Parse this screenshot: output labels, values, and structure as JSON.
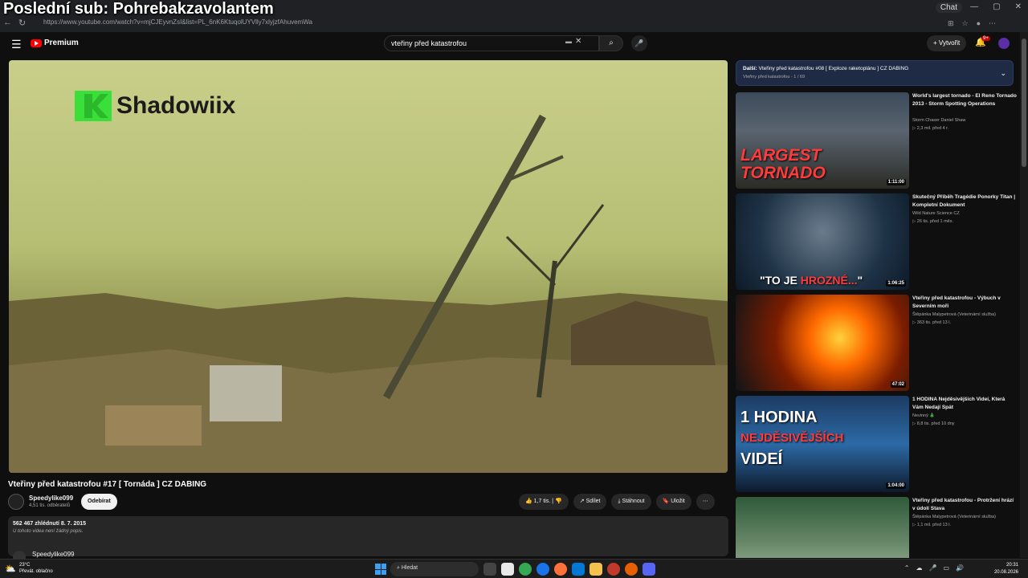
{
  "overlay": {
    "title": "Poslední sub: Pohrebakzavolantem"
  },
  "browser": {
    "url": "https://www.youtube.com/watch?v=mjCJEyvnZsI&list=PL_6nK6KtuqolUYVlly7xlyjzfAhuvemWa",
    "chat_label": "Chat"
  },
  "header": {
    "logo_text": "Premium",
    "search_value": "vteřiny před katastrofou",
    "create_label": "Vytvořit",
    "notif_badge": "9+"
  },
  "video": {
    "watermark": "Shadowiix",
    "title": "Vteřiny před katastrofou #17 [ Tornáda ] CZ DABING",
    "channel": "Speedylike099",
    "subscribers": "4,51 tis. odběratelů",
    "subscribe_label": "Odebírat",
    "likes": "1,7 tis.",
    "share_label": "Sdílet",
    "download_label": "Stáhnout",
    "save_label": "Uložit",
    "views_date": "562 467 zhlédnutí  8. 7. 2015",
    "description": "U tohoto videa není žádný popis.",
    "comment_author": "Speedylike099"
  },
  "next": {
    "label": "Další:",
    "title": "Vteřiny před katastrofou #08 [ Exploze raketoplánu ] CZ DABING",
    "sub": "Vteřiny před katastrofou - 1 / 69"
  },
  "recommendations": [
    {
      "title": "World's largest tornado - El Reno Tornado 2013 - Storm Spotting Operations",
      "channel": "Storm Chaser Daniel Shaw",
      "meta": "▷ 2,3 mil.   před 4 r.",
      "duration": "1:11:00",
      "thumb_text": "LARGEST TORNADO"
    },
    {
      "title": "Skutečný Příběh Tragédie Ponorky Titan | Kompletní Dokument",
      "channel": "Wild Nature Science CZ",
      "meta": "▷ 26 tis.   před 1 měs.",
      "duration": "1:06:25",
      "thumb_text_1": "\"TO JE ",
      "thumb_text_2": "HROZNÉ...",
      "thumb_text_3": "\""
    },
    {
      "title": "Vteřiny před katastrofou - Výbuch v Severním moři",
      "channel": "Štěpánka Malypetrová (Veterinární služba)",
      "meta": "▷ 363 tis.   před 13 l.",
      "duration": "47:02"
    },
    {
      "title": "1 HODINA Nejděsivějších Videí, Která Vám Nedají Spát",
      "channel": "Nevinný 🎄",
      "meta": "▷ 8,8 tis.   před 10 dny",
      "duration": "1:04:00",
      "thumb_text_1": "1 HODINA",
      "thumb_text_2": "NEJDĚSIVĚJŠÍCH",
      "thumb_text_3": "VIDEÍ"
    },
    {
      "title": "Vteřiny před katastrofou - Protržení hrází v údolí Stava",
      "channel": "Štěpánka Malypetrová (Veterinární služba)",
      "meta": "▷ 1,1 mil.   před 13 l."
    }
  ],
  "taskbar": {
    "temp": "23°C",
    "weather": "Převát. oblačno",
    "search_placeholder": "Hledat",
    "time": "20:31",
    "date": "20.08.2026"
  },
  "colors": {
    "accent_red": "#ff0000",
    "next_box": "#1f2a44"
  }
}
